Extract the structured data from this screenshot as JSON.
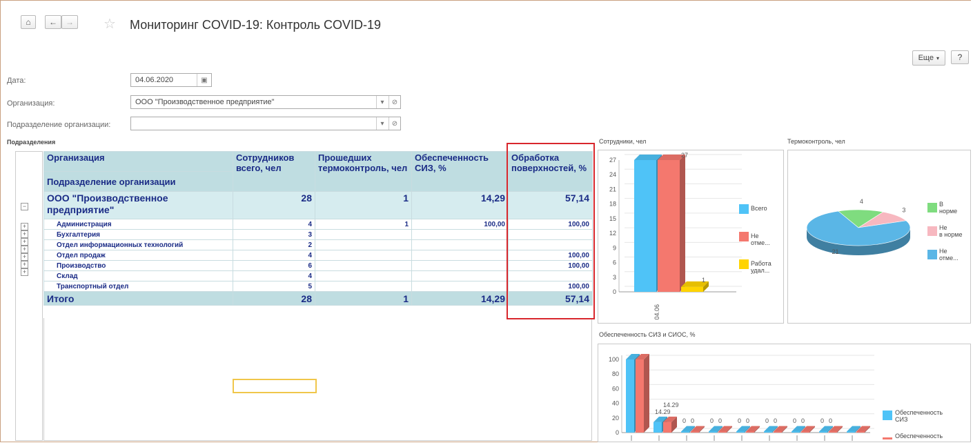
{
  "window": {
    "title": "Мониторинг COVID-19: Контроль COVID-19"
  },
  "toolbar": {
    "home": "⌂",
    "back": "←",
    "forward": "→",
    "star": "☆",
    "more_label": "Еще",
    "help_label": "?"
  },
  "form": {
    "date_label": "Дата:",
    "date_value": "04.06.2020",
    "org_label": "Организация:",
    "org_value": "ООО \"Производственное предприятие\"",
    "dept_label": "Подразделение организации:",
    "dept_value": ""
  },
  "sections": {
    "departments": "Подразделения",
    "employees_chart": "Сотрудники, чел",
    "thermo_chart": "Термоконтроль, чел",
    "ppe_chart": "Обеспеченность СИЗ и СИОС, %"
  },
  "table": {
    "header": {
      "org": "Организация",
      "dept": "Подразделение организации",
      "employees": "Сотрудников всего, чел",
      "passed": "Прошедших термоконтроль, чел",
      "ppe": "Обеспеченность СИЗ, %",
      "surfaces": "Обработка поверхностей, %"
    },
    "org_row": {
      "name": "ООО \"Производственное предприятие\"",
      "employees": "28",
      "passed": "1",
      "ppe": "14,29",
      "surfaces": "57,14"
    },
    "rows": [
      {
        "name": "Администрация",
        "employees": "4",
        "passed": "1",
        "ppe": "100,00",
        "surfaces": "100,00"
      },
      {
        "name": "Бухгалтерия",
        "employees": "3",
        "passed": "",
        "ppe": "",
        "surfaces": ""
      },
      {
        "name": "Отдел информационных технологий",
        "employees": "2",
        "passed": "",
        "ppe": "",
        "surfaces": ""
      },
      {
        "name": "Отдел продаж",
        "employees": "4",
        "passed": "",
        "ppe": "",
        "surfaces": "100,00"
      },
      {
        "name": "Производство",
        "employees": "6",
        "passed": "",
        "ppe": "",
        "surfaces": "100,00"
      },
      {
        "name": "Склад",
        "employees": "4",
        "passed": "",
        "ppe": "",
        "surfaces": ""
      },
      {
        "name": "Транспортный отдел",
        "employees": "5",
        "passed": "",
        "ppe": "",
        "surfaces": "100,00"
      }
    ],
    "total": {
      "name": "Итого",
      "employees": "28",
      "passed": "1",
      "ppe": "14,29",
      "surfaces": "57,14"
    }
  },
  "chart_data": [
    {
      "type": "bar",
      "categories": [
        "04.06"
      ],
      "series": [
        {
          "name": "Всего",
          "values": [
            28
          ],
          "color": "#4fc3f7"
        },
        {
          "name": "Не отме...",
          "values": [
            27
          ],
          "color": "#f4786e"
        },
        {
          "name": "Работа удал...",
          "values": [
            1
          ],
          "color": "#ffd400"
        }
      ],
      "data_labels": [
        "27",
        "1"
      ],
      "ylim": [
        0,
        27
      ],
      "yticks": [
        0,
        3,
        6,
        9,
        12,
        15,
        18,
        21,
        24,
        27
      ],
      "legend": "right"
    },
    {
      "type": "pie",
      "slices": [
        {
          "name": "В норме",
          "value": 4,
          "color": "#7fdc7f"
        },
        {
          "name": "Не в норме",
          "value": 3,
          "color": "#f7b8c0"
        },
        {
          "name": "Не отме...",
          "value": 21,
          "color": "#5ab6e6"
        }
      ],
      "legend": "right"
    },
    {
      "type": "bar",
      "categories": [
        "",
        "",
        "",
        "",
        "",
        "",
        "",
        "",
        ""
      ],
      "series": [
        {
          "name": "Обеспеченность СИЗ",
          "values": [
            100,
            14.29,
            0,
            0,
            0,
            0,
            0,
            0,
            0
          ],
          "color": "#4fc3f7"
        },
        {
          "name": "Обеспеченность",
          "values": [
            100,
            14.29,
            0,
            0,
            0,
            0,
            0,
            0,
            0
          ],
          "color": "#f4786e"
        }
      ],
      "data_labels": [
        "14.29",
        "14.29",
        "0",
        "0",
        "0",
        "0",
        "0",
        "0",
        "0",
        "0",
        "0",
        "0",
        "0",
        "0"
      ],
      "ylim": [
        0,
        100
      ],
      "yticks": [
        0,
        20,
        40,
        60,
        80,
        100
      ],
      "legend": "right"
    }
  ],
  "colors": {
    "header_bg": "#bfdde1",
    "header_text": "#1a2b86",
    "highlight_border": "#d8262c",
    "focus_border": "#f0c64a"
  }
}
